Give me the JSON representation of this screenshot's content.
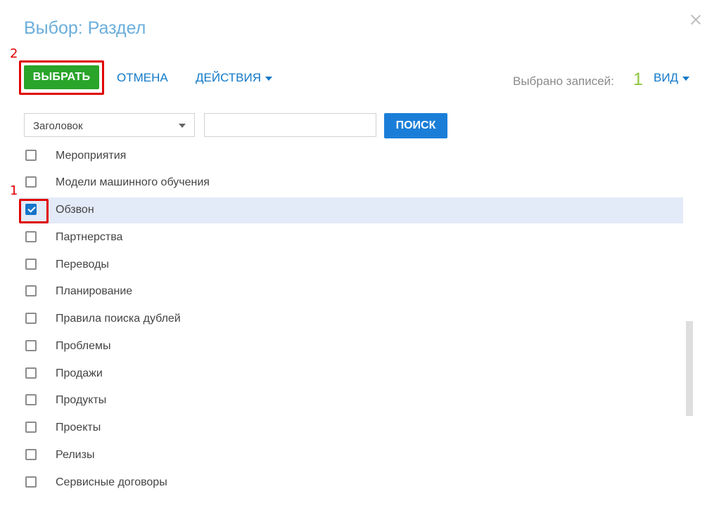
{
  "dialog": {
    "title": "Выбор: Раздел"
  },
  "callouts": {
    "one": "1",
    "two": "2"
  },
  "toolbar": {
    "select_label": "ВЫБРАТЬ",
    "cancel_label": "ОТМЕНА",
    "actions_label": "ДЕЙСТВИЯ",
    "selected_count_label": "Выбрано записей:",
    "selected_count": "1",
    "view_label": "ВИД"
  },
  "filter": {
    "field_value": "Заголовок",
    "search_value": "",
    "search_button_label": "ПОИСК"
  },
  "list": {
    "items": [
      {
        "label": "Мероприятия",
        "checked": false
      },
      {
        "label": "Модели машинного обучения",
        "checked": false
      },
      {
        "label": "Обзвон",
        "checked": true
      },
      {
        "label": "Партнерства",
        "checked": false
      },
      {
        "label": "Переводы",
        "checked": false
      },
      {
        "label": "Планирование",
        "checked": false
      },
      {
        "label": "Правила поиска дублей",
        "checked": false
      },
      {
        "label": "Проблемы",
        "checked": false
      },
      {
        "label": "Продажи",
        "checked": false
      },
      {
        "label": "Продукты",
        "checked": false
      },
      {
        "label": "Проекты",
        "checked": false
      },
      {
        "label": "Релизы",
        "checked": false
      },
      {
        "label": "Сервисные договоры",
        "checked": false
      }
    ]
  },
  "colors": {
    "title": "#6aaedc",
    "select_button": "#2aa52a",
    "link": "#1179c8",
    "search_button": "#1a7ed8",
    "selected_row": "#e3eaf8",
    "count": "#8dc63f",
    "callout": "#e00000"
  },
  "icons": [
    "close-icon",
    "chevron-down-icon",
    "checkbox-icon"
  ]
}
